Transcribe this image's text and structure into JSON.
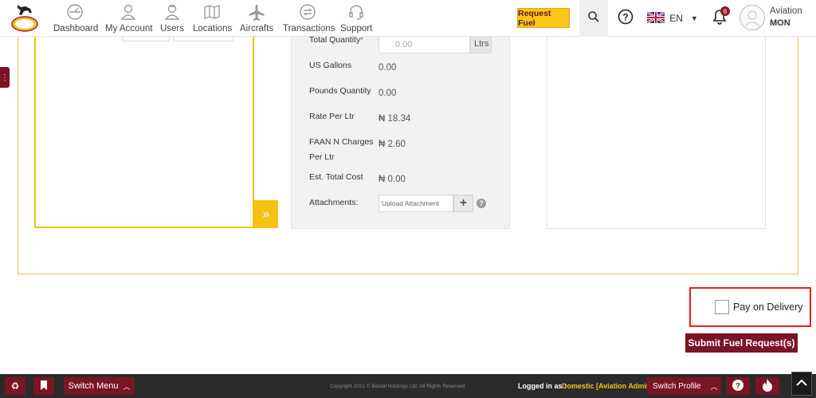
{
  "nav": {
    "items": [
      {
        "label": "Dashboard",
        "icon": "dashboard-icon"
      },
      {
        "label": "My Account",
        "icon": "account-icon"
      },
      {
        "label": "Users",
        "icon": "users-icon"
      },
      {
        "label": "Locations",
        "icon": "map-icon"
      },
      {
        "label": "Aircrafts",
        "icon": "airplane-icon"
      },
      {
        "label": "Transactions",
        "icon": "transactions-icon"
      },
      {
        "label": "Support",
        "icon": "headset-icon"
      }
    ],
    "request_fuel": "Request Fuel",
    "language": "EN",
    "notification_count": "6",
    "user_name": "Aviation",
    "user_role": "MON"
  },
  "form": {
    "total_quantity_label": "Total Quantity",
    "required_mark": "*",
    "total_quantity_placeholder": "0.00",
    "unit": "Ltrs",
    "us_gallons_label": "US Gallons",
    "us_gallons_value": "0.00",
    "pounds_label": "Pounds Quantity",
    "pounds_value": "0.00",
    "rate_label": "Rate Per Ltr",
    "rate_value": "₦ 18.34",
    "faan_label_line1": "FAAN N Charges",
    "faan_label_line2": "Per Ltr",
    "faan_value": "₦ 2.60",
    "est_total_label": "Est. Total Cost",
    "est_total_value": "₦ 0.00",
    "attachments_label": "Attachments:",
    "upload_placeholder": "Upload Attachment"
  },
  "pay_on_delivery": "Pay on Delivery",
  "submit": "Submit Fuel Request(s)",
  "footer": {
    "switch_menu": "Switch Menu",
    "copyright": "Copyright 2021 © Bestaf Holdings Ltd. All Rights Reserved",
    "logged_in_label": "Logged in as :",
    "logged_in_value": "Domestic [Aviation Admin]",
    "switch_profile": "Switch Profile"
  },
  "colors": {
    "brand": "#7a1426",
    "accent": "#f5c211",
    "highlight": "#e0201e"
  }
}
